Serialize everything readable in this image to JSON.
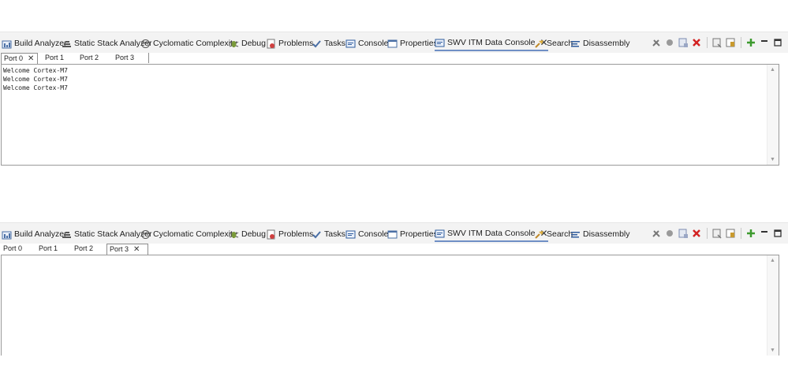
{
  "panels": [
    {
      "view_tabs": [
        {
          "label": "Build Analyzer",
          "icon": "build-analyzer-icon"
        },
        {
          "label": "Static Stack Analyzer",
          "icon": "stack-icon"
        },
        {
          "label": "Cyclomatic Complexity",
          "icon": "complexity-icon"
        },
        {
          "label": "Debug",
          "icon": "bug-icon"
        },
        {
          "label": "Problems",
          "icon": "problems-icon"
        },
        {
          "label": "Tasks",
          "icon": "tasks-icon"
        },
        {
          "label": "Console",
          "icon": "console-icon"
        },
        {
          "label": "Properties",
          "icon": "properties-icon"
        },
        {
          "label": "SWV ITM Data Console",
          "icon": "swv-console-icon",
          "active": true
        },
        {
          "label": "Search",
          "icon": "search-icon"
        },
        {
          "label": "Disassembly",
          "icon": "disassembly-icon"
        }
      ],
      "port_tabs": [
        "Port 0",
        "Port 1",
        "Port 2",
        "Port 3"
      ],
      "selected_port": 0,
      "console_lines": [
        "Welcome Cortex-M7",
        "Welcome Cortex-M7",
        "Welcome Cortex-M7"
      ]
    },
    {
      "view_tabs": [
        {
          "label": "Build Analyzer",
          "icon": "build-analyzer-icon"
        },
        {
          "label": "Static Stack Analyzer",
          "icon": "stack-icon"
        },
        {
          "label": "Cyclomatic Complexity",
          "icon": "complexity-icon"
        },
        {
          "label": "Debug",
          "icon": "bug-icon"
        },
        {
          "label": "Problems",
          "icon": "problems-icon"
        },
        {
          "label": "Tasks",
          "icon": "tasks-icon"
        },
        {
          "label": "Console",
          "icon": "console-icon"
        },
        {
          "label": "Properties",
          "icon": "properties-icon"
        },
        {
          "label": "SWV ITM Data Console",
          "icon": "swv-console-icon",
          "active": true
        },
        {
          "label": "Search",
          "icon": "search-icon"
        },
        {
          "label": "Disassembly",
          "icon": "disassembly-icon"
        }
      ],
      "port_tabs": [
        "Port 0",
        "Port 1",
        "Port 2",
        "Port 3"
      ],
      "selected_port": 3,
      "console_lines": []
    }
  ],
  "toolbar_icons": [
    "configure-trace-icon",
    "start-trace-icon",
    "remove-all-icon",
    "terminate-icon",
    "clear-icon",
    "lock-scroll-icon",
    "add-port-icon",
    "minimize-icon",
    "maximize-icon"
  ],
  "colors": {
    "active_tab_underline": "#6f8fc5",
    "terminate": "#d32222",
    "add": "#3d9a2e",
    "view_bar": "#f3f3f3"
  }
}
